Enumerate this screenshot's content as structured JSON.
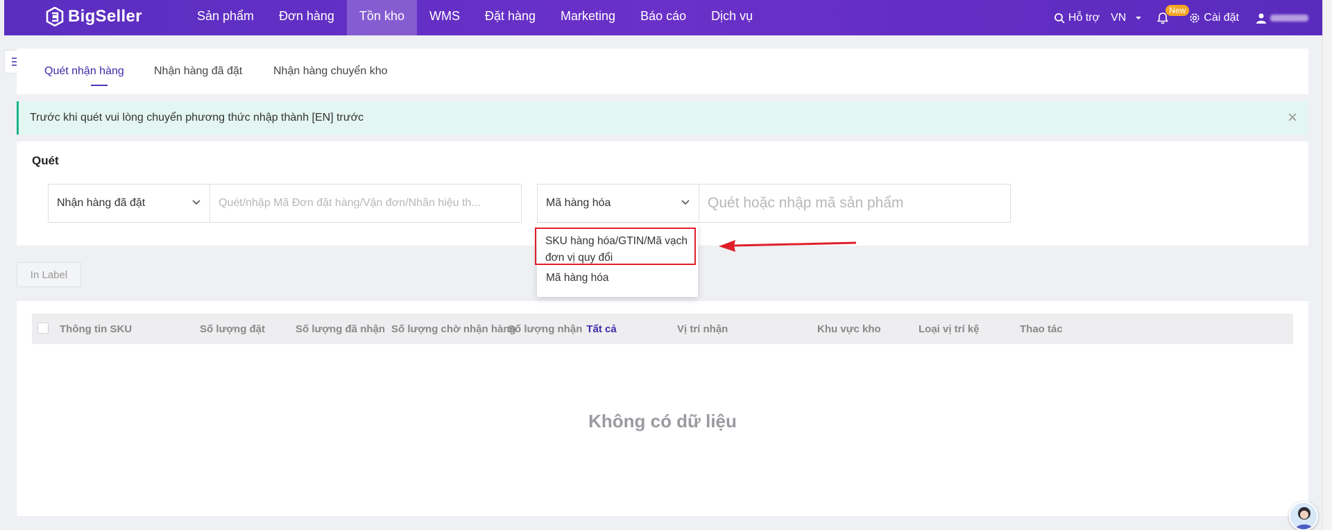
{
  "brand": {
    "name": "BigSeller"
  },
  "nav": {
    "items": [
      "Sản phẩm",
      "Đơn hàng",
      "Tồn kho",
      "WMS",
      "Đặt hàng",
      "Marketing",
      "Báo cáo",
      "Dịch vụ"
    ],
    "active_index": 2,
    "support_label": "Hỗ trợ",
    "language": "VN",
    "new_badge": "New",
    "settings_label": "Cài đặt"
  },
  "tabs": {
    "items": [
      "Quét nhận hàng",
      "Nhận hàng đã đặt",
      "Nhận hàng chuyển kho"
    ],
    "active_index": 0
  },
  "alert": {
    "message": "Trước khi quét vui lòng chuyển phương thức nhập thành [EN] trước",
    "close_icon": "×"
  },
  "scan": {
    "title": "Quét",
    "order_type_value": "Nhận hàng đã đặt",
    "order_input_placeholder": "Quét/nhập Mã Đơn đặt hàng/Vận đơn/Nhãn hiệu th...",
    "code_type_value": "Mã hàng hóa",
    "product_input_placeholder": "Quét hoặc nhập mã sản phẩm"
  },
  "dropdown": {
    "options": [
      "SKU hàng hóa/GTIN/Mã vạch đơn vị quy đổi",
      "Mã hàng hóa"
    ],
    "highlighted_index": 0
  },
  "toolbar": {
    "print_label": "In Label"
  },
  "table": {
    "columns": [
      "Thông tin SKU",
      "Số lượng đặt",
      "Số lượng đã nhận",
      "Số lượng chờ nhận hàng",
      "Số lượng nhận",
      "Vị trí nhận",
      "Khu vực kho",
      "Loại vị trí kệ",
      "Thao tác"
    ],
    "receive_all_link": "Tất cả",
    "empty_text": "Không có dữ liệu"
  },
  "colors": {
    "nav_bg": "#5b2ec0",
    "accent": "#3d2ba8",
    "alert_bg": "#e3f6f1",
    "alert_border": "#19b38a",
    "highlight_red": "#e01e2a"
  }
}
